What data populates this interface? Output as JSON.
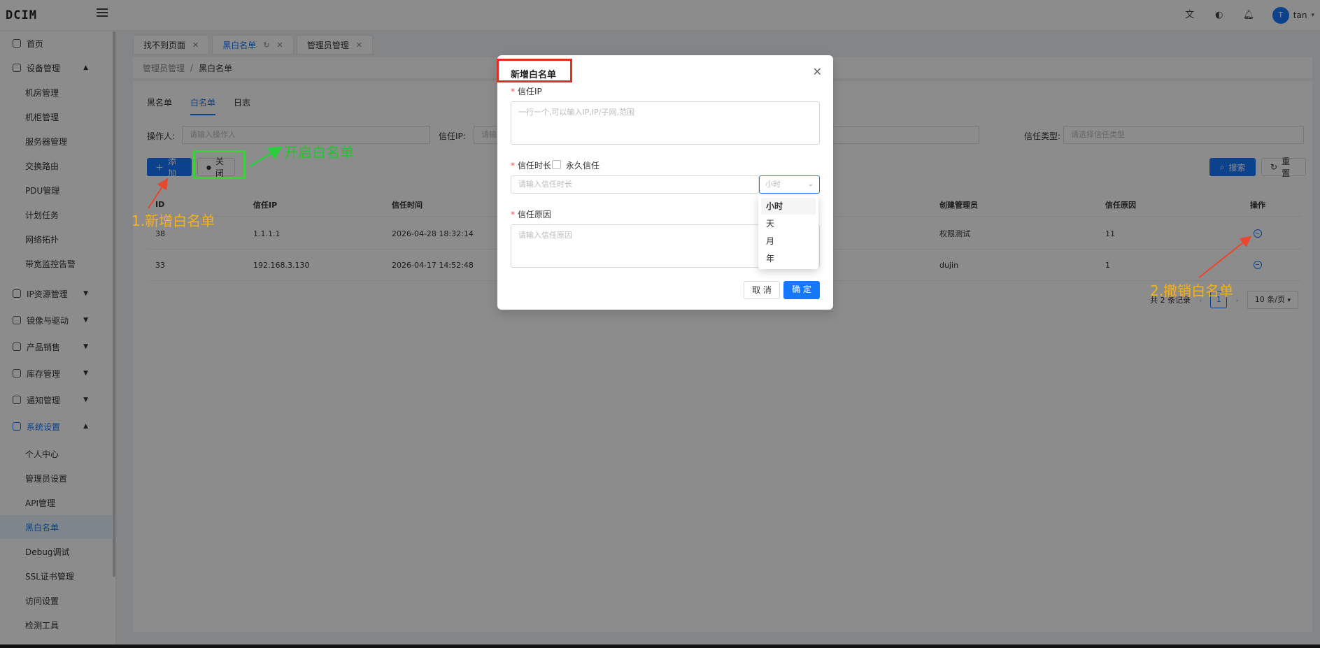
{
  "app": {
    "logo": "DCIM"
  },
  "topbar": {
    "user_initial": "T",
    "user_name": "tan"
  },
  "sidebar": {
    "items": [
      {
        "label": "首页"
      },
      {
        "label": "设备管理"
      },
      {
        "label": "IP资源管理"
      },
      {
        "label": "镜像与驱动"
      },
      {
        "label": "产品销售"
      },
      {
        "label": "库存管理"
      },
      {
        "label": "通知管理"
      },
      {
        "label": "系统设置"
      }
    ],
    "device_sub": [
      "机房管理",
      "机柜管理",
      "服务器管理",
      "交换路由",
      "PDU管理",
      "计划任务",
      "网络拓扑",
      "带宽监控告警"
    ],
    "system_sub": [
      "个人中心",
      "管理员设置",
      "API管理",
      "黑白名单",
      "Debug调试",
      "SSL证书管理",
      "访问设置",
      "检测工具"
    ]
  },
  "tabs": [
    {
      "label": "找不到页面"
    },
    {
      "label": "黑白名单"
    },
    {
      "label": "管理员管理"
    }
  ],
  "breadcrumb": {
    "parent": "管理员管理",
    "sep": "/",
    "current": "黑白名单"
  },
  "subtabs": [
    "黑名单",
    "白名单",
    "日志"
  ],
  "filters": {
    "operator_label": "操作人:",
    "operator_placeholder": "请输入操作人",
    "ip_label": "信任IP:",
    "ip_placeholder": "请输",
    "type_label": "信任类型:",
    "type_placeholder": "请选择信任类型"
  },
  "actions": {
    "add": "添加",
    "toggle": "关闭",
    "search": "搜索",
    "reset": "重置"
  },
  "table": {
    "headers": [
      "ID",
      "信任IP",
      "信任时间",
      "创建管理员",
      "信任原因",
      "操作"
    ],
    "rows": [
      {
        "id": "38",
        "ip": "1.1.1.1",
        "time": "2026-04-28 18:32:14",
        "admin": "权限测试",
        "reason": "11"
      },
      {
        "id": "33",
        "ip": "192.168.3.130",
        "time": "2026-04-17 14:52:48",
        "admin": "dujin",
        "reason": "1"
      }
    ]
  },
  "pager": {
    "total": "共 2 条记录",
    "page": "1",
    "size": "10 条/页"
  },
  "modal": {
    "title": "新增白名单",
    "ip_label": "信任IP",
    "ip_placeholder": "一行一个,可以输入IP,IP/子网,范围",
    "duration_label": "信任时长",
    "permanent_label": "永久信任",
    "duration_placeholder": "请输入信任时长",
    "unit_value": "小时",
    "reason_label": "信任原因",
    "reason_placeholder": "请输入信任原因",
    "cancel": "取 消",
    "ok": "确 定",
    "unit_options": [
      "小时",
      "天",
      "月",
      "年"
    ]
  },
  "annotations": {
    "step1": "1.新增白名单",
    "step2": "2.撤销白名单",
    "toggle_note": "开启白名单"
  },
  "colors": {
    "primary": "#1677ff",
    "annotation_orange": "#f5b21b",
    "annotation_green": "#27c232",
    "highlight_red": "#e02e24"
  }
}
